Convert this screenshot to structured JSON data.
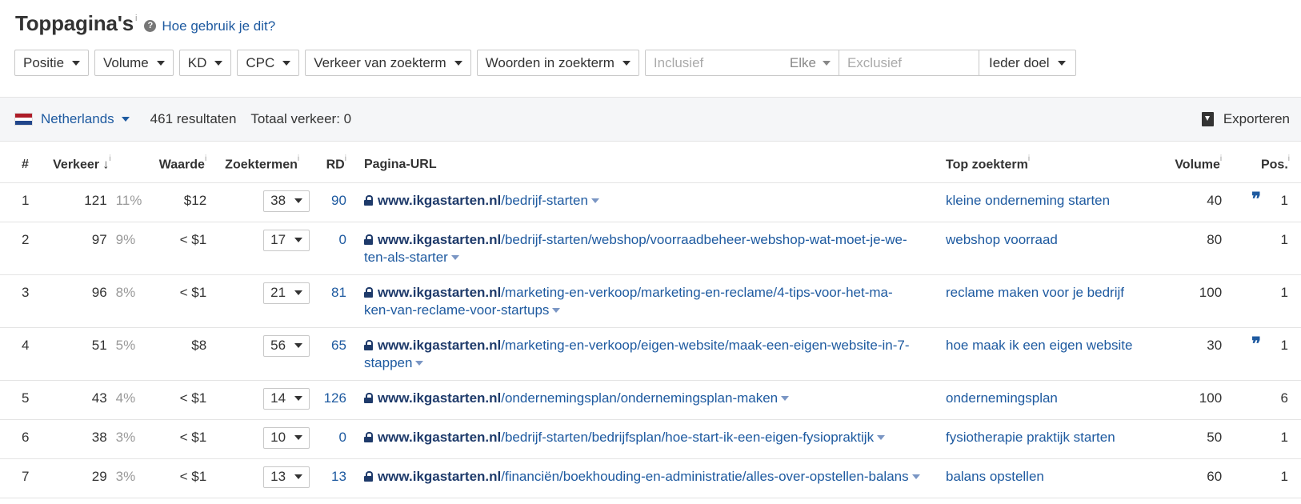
{
  "header": {
    "title": "Toppagina's",
    "info": "i",
    "help_icon": "?",
    "help_link": "Hoe gebruik je dit?"
  },
  "filters": {
    "positie": "Positie",
    "volume": "Volume",
    "kd": "KD",
    "cpc": "CPC",
    "verkeer": "Verkeer van zoekterm",
    "woorden": "Woorden in zoekterm",
    "inclusief_placeholder": "Inclusief",
    "elke": "Elke",
    "exclusief_placeholder": "Exclusief",
    "doel": "Ieder doel"
  },
  "results_bar": {
    "country": "Netherlands",
    "results_count": "461 resultaten",
    "total_traffic": "Totaal verkeer: 0",
    "export": "Exporteren",
    "flag_colors": [
      "#ae1c28",
      "#ffffff",
      "#21468b"
    ]
  },
  "table": {
    "headers": {
      "num": "#",
      "traffic": "Verkeer",
      "sort_arrow": "↓",
      "value": "Waarde",
      "keywords": "Zoektermen",
      "rd": "RD",
      "url": "Pagina-URL",
      "top_keyword": "Top zoekterm",
      "volume": "Volume",
      "pos": "Pos.",
      "info": "i"
    },
    "rows": [
      {
        "num": "1",
        "traffic": "121",
        "pct": "11%",
        "value": "$12",
        "keywords": "38",
        "rd": "90",
        "domain": "www.ikgastarten.nl",
        "path1": "/bedrijf-starten",
        "path2": "",
        "top": "kleine onderneming starten",
        "volume": "40",
        "featured": "❞",
        "pos": "1"
      },
      {
        "num": "2",
        "traffic": "97",
        "pct": "9%",
        "value": "< $1",
        "keywords": "17",
        "rd": "0",
        "domain": "www.ikgastarten.nl",
        "path1": "/bedrijf-starten/webshop/voorraadbeheer-webshop-wat-moet-je-we-",
        "path2": "ten-als-starter",
        "top": "webshop voorraad",
        "volume": "80",
        "featured": "",
        "pos": "1"
      },
      {
        "num": "3",
        "traffic": "96",
        "pct": "8%",
        "value": "< $1",
        "keywords": "21",
        "rd": "81",
        "domain": "www.ikgastarten.nl",
        "path1": "/marketing-en-verkoop/marketing-en-reclame/4-tips-voor-het-ma-",
        "path2": "ken-van-reclame-voor-startups",
        "top": "reclame maken voor je bedrijf",
        "volume": "100",
        "featured": "",
        "pos": "1"
      },
      {
        "num": "4",
        "traffic": "51",
        "pct": "5%",
        "value": "$8",
        "keywords": "56",
        "rd": "65",
        "domain": "www.ikgastarten.nl",
        "path1": "/marketing-en-verkoop/eigen-website/maak-een-eigen-website-in-7-",
        "path2": "stappen",
        "top": "hoe maak ik een eigen website",
        "volume": "30",
        "featured": "❞",
        "pos": "1"
      },
      {
        "num": "5",
        "traffic": "43",
        "pct": "4%",
        "value": "< $1",
        "keywords": "14",
        "rd": "126",
        "domain": "www.ikgastarten.nl",
        "path1": "/ondernemingsplan/ondernemingsplan-maken",
        "path2": "",
        "top": "ondernemingsplan",
        "volume": "100",
        "featured": "",
        "pos": "6"
      },
      {
        "num": "6",
        "traffic": "38",
        "pct": "3%",
        "value": "< $1",
        "keywords": "10",
        "rd": "0",
        "domain": "www.ikgastarten.nl",
        "path1": "/bedrijf-starten/bedrijfsplan/hoe-start-ik-een-eigen-fysiopraktijk",
        "path2": "",
        "top": "fysiotherapie praktijk starten",
        "volume": "50",
        "featured": "",
        "pos": "1"
      },
      {
        "num": "7",
        "traffic": "29",
        "pct": "3%",
        "value": "< $1",
        "keywords": "13",
        "rd": "13",
        "domain": "www.ikgastarten.nl",
        "path1": "/financiën/boekhouding-en-administratie/alles-over-opstellen-balans",
        "path2": "",
        "top": "balans opstellen",
        "volume": "60",
        "featured": "",
        "pos": "1"
      }
    ]
  }
}
